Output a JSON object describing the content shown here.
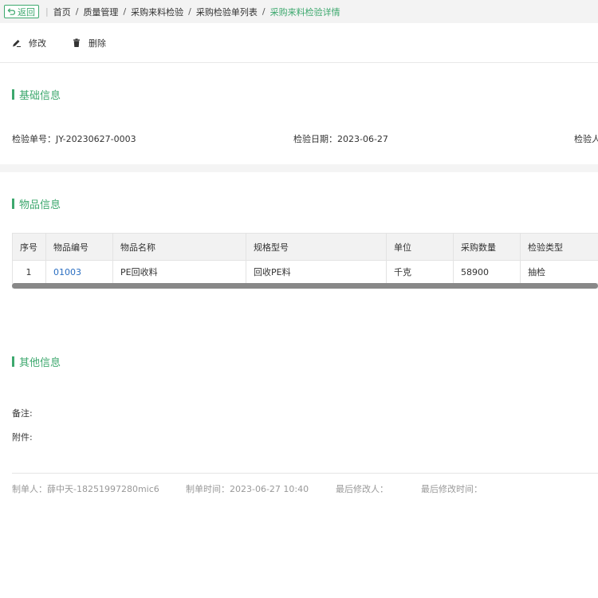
{
  "breadcrumb": {
    "back_label": "返回",
    "items": [
      "首页",
      "质量管理",
      "采购来料检验",
      "采购检验单列表"
    ],
    "current": "采购来料检验详情",
    "separator": "/"
  },
  "toolbar": {
    "edit_label": "修改",
    "delete_label": "删除"
  },
  "basic": {
    "title": "基础信息",
    "inspection_no_label": "检验单号：",
    "inspection_no": "JY-20230627-0003",
    "date_label": "检验日期：",
    "date": "2023-06-27",
    "inspector_label": "检验人"
  },
  "items": {
    "title": "物品信息",
    "columns": [
      "序号",
      "物品编号",
      "物品名称",
      "规格型号",
      "单位",
      "采购数量",
      "检验类型"
    ],
    "rows": [
      [
        "1",
        "01003",
        "PE回收料",
        "回收PE料",
        "千克",
        "58900",
        "抽检"
      ]
    ]
  },
  "other": {
    "title": "其他信息",
    "remark_label": "备注:",
    "attachment_label": "附件:"
  },
  "meta": {
    "creator_label": "制单人：",
    "creator": "薛中天-18251997280mic6",
    "created_time_label": "制单时间：",
    "created_time": "2023-06-27 10:40",
    "modifier_label": "最后修改人：",
    "modified_time_label": "最后修改时间："
  },
  "colors": {
    "accent": "#3da86e",
    "link": "#2a6ec1"
  }
}
